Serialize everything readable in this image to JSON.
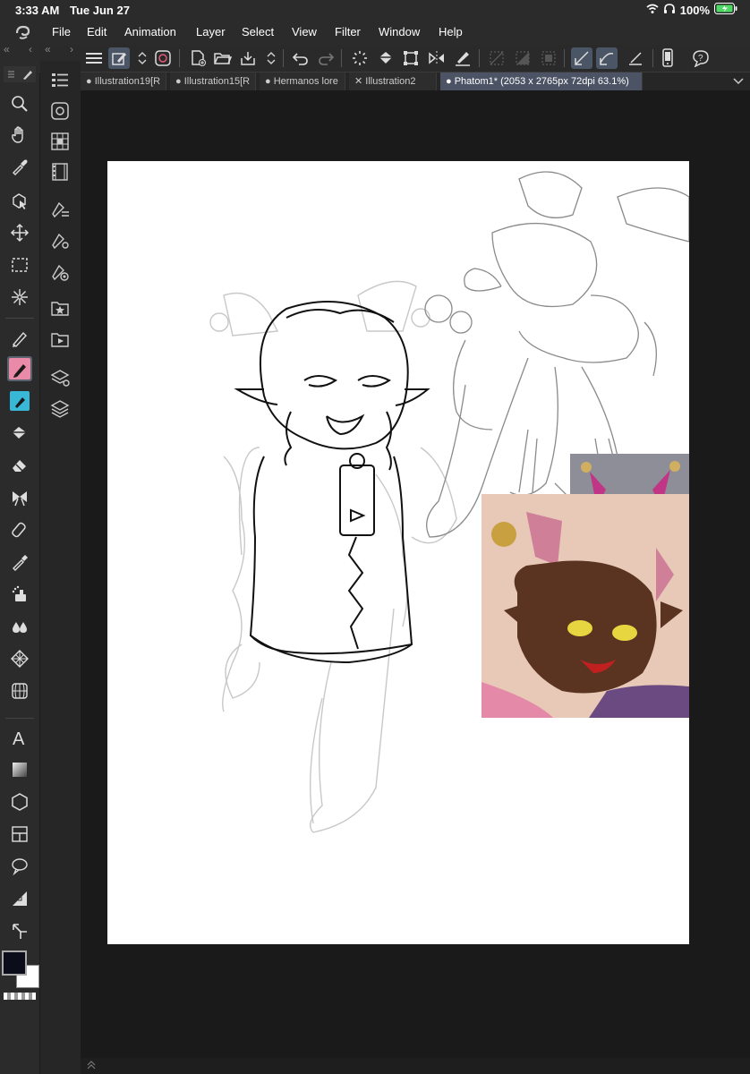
{
  "status_bar": {
    "time": "3:33 AM",
    "date": "Tue Jun 27",
    "battery": "100%"
  },
  "menu": {
    "items": [
      "File",
      "Edit",
      "Animation",
      "Layer",
      "Select",
      "View",
      "Filter",
      "Window",
      "Help"
    ]
  },
  "tabs": [
    {
      "label": "Illustration19[R"
    },
    {
      "label": "Illustration15[R"
    },
    {
      "label": "Hermanos lore"
    },
    {
      "label": "Illustration2"
    },
    {
      "label": "Phatom1* (2053 x 2765px 72dpi 63.1%)"
    }
  ],
  "colors": {
    "accent": "#4b5364",
    "main_color": "#0b0e1a",
    "sub_color": "#ffffff",
    "active_tool": "#e98aa8",
    "active_tool2": "#39b7d6"
  }
}
